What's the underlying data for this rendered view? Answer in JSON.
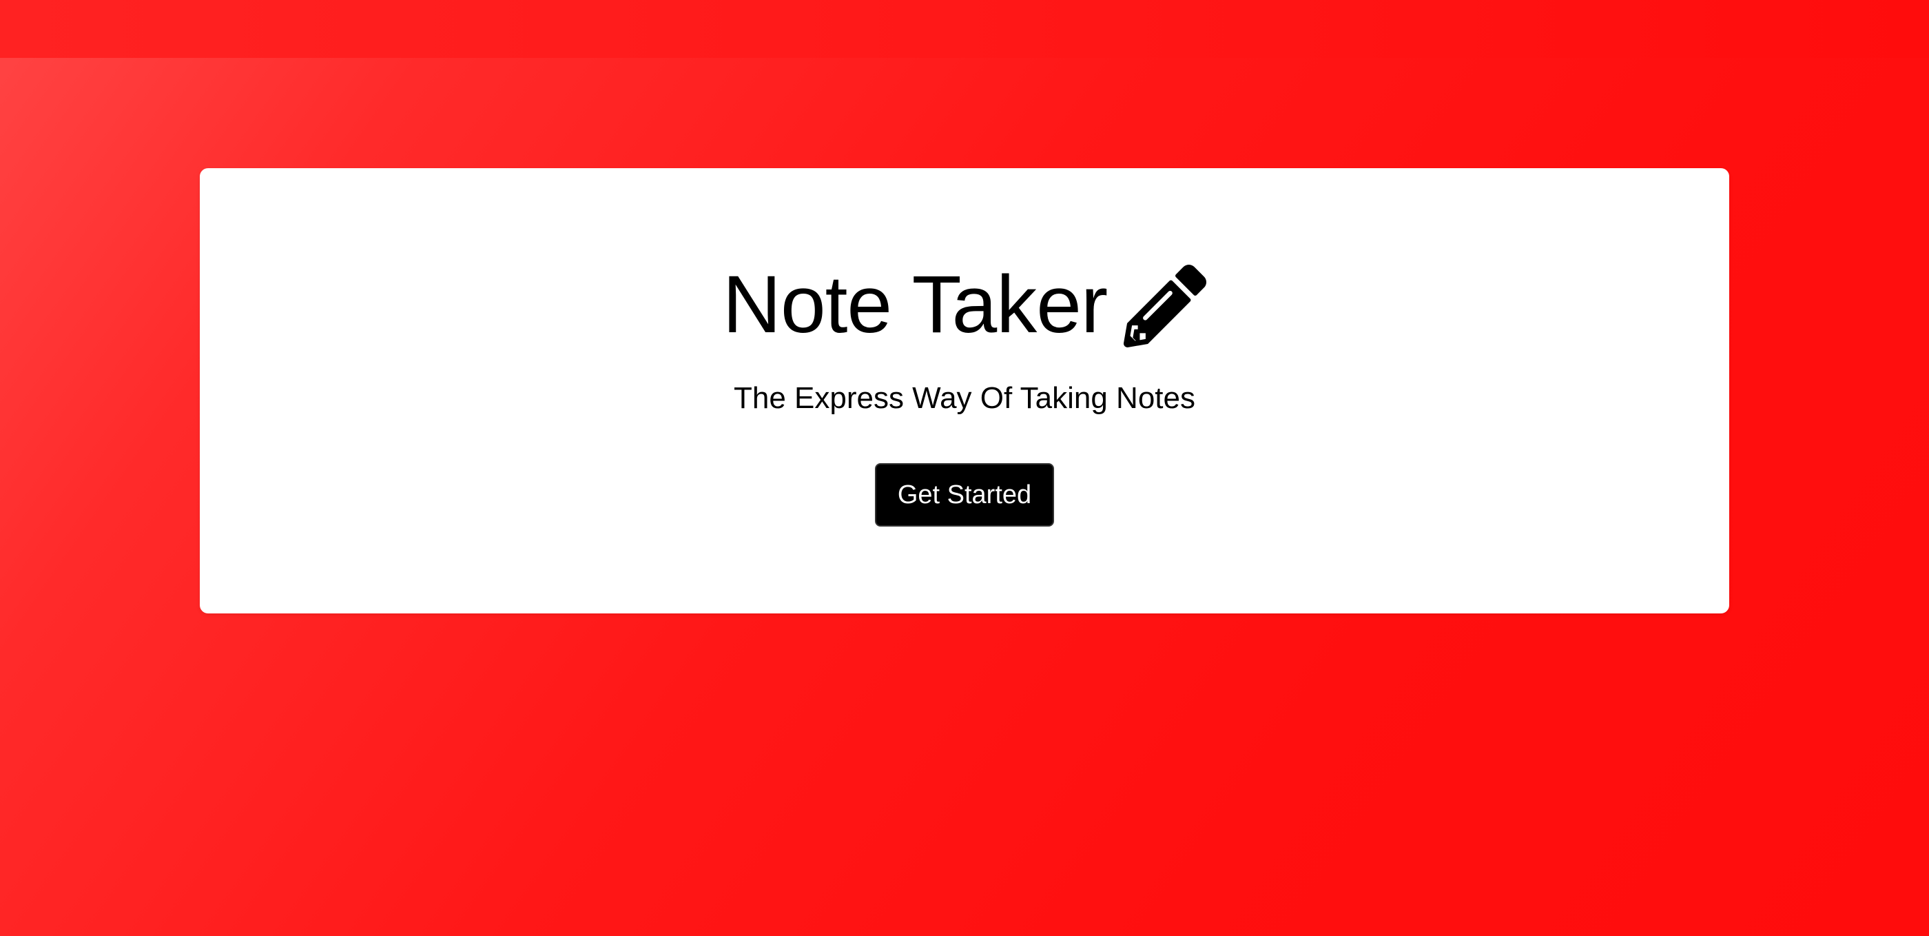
{
  "navbar": {
    "background_color": "#ff1a1a"
  },
  "hero": {
    "title": "Note Taker",
    "title_icon": "pencil-icon",
    "subtitle": "The Express Way Of Taking Notes",
    "cta_label": "Get Started"
  },
  "colors": {
    "background_gradient_start": "#ff4545",
    "background_gradient_end": "#ff0c0c",
    "card": "#ffffff",
    "button": "#000000",
    "button_text": "#ffffff"
  }
}
